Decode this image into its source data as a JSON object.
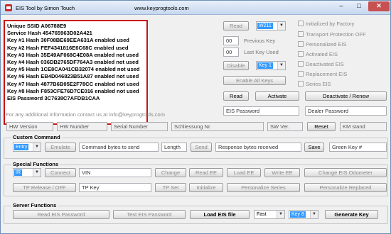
{
  "window": {
    "title": "EIS Tool by Simon Touch",
    "website": "www.keyprogtools.com"
  },
  "output_lines": [
    "Unique  SSID  A06788E9",
    "Service Hash  454765963D02A421",
    " Key #1 Hash  30F08BE69EEA631A  enabled  used",
    " Key #2 Hash  FEF4341816E6C68C  enabled  used",
    " Key #3 Hash  35E49AF068C4E08A  enabled  not used",
    " Key #4 Hash  036DB2765DF764A3  enabled  not used",
    " Key #5 Hash  1CE8CA041CB32074  enabled  not used",
    " Key #6 Hash  EB4D046823B51A87  enabled  not used",
    " Key #7 Hash  4877B6B05E2F78CC  enabled  not used",
    " Key #8 Hash  F853CFE76D7CE016  enabled  not used",
    "EIS Password  3C7638C7AFDB1CAA"
  ],
  "contact_text": "For any additional information contact us at info@keyprogtools.com",
  "right_panel": {
    "read_label": "Read",
    "read_select": "W211",
    "previous_key_value": "00",
    "previous_key_label": "Previous Key",
    "last_key_value": "00",
    "last_key_label": "Last Key Used",
    "disable_label": "Disable",
    "key_select": "Key 1",
    "enable_all_label": "Enable All Keys",
    "read2_label": "Read",
    "activate_label": "Activate",
    "deactivate_label": "Deactivate / Renew",
    "eis_password_field": "EIS Password",
    "dealer_password_field": "Dealer Password"
  },
  "checkboxes": [
    "Initialized by Factory",
    "Transport Protection OFF",
    "Personalized EIS",
    "Activated EIS",
    "Deactivated EIS",
    "Replacement EIS",
    "Series EIS"
  ],
  "info_row": {
    "hw_version": "HW Version",
    "hw_number": "HW Number",
    "serial_number": "Serial Number",
    "schliessung": "Schliessung Nr.",
    "sw_ver": "SW Ver.",
    "reset_label": "Reset",
    "km_stand": "KM stand"
  },
  "custom_command": {
    "title": "Custom Command",
    "select": "Entry",
    "emulate_label": "Emulate",
    "bytes_to_send": "Command bytes to send",
    "length": "Length",
    "send_label": "Send",
    "bytes_received": "Response bytes received",
    "save_label": "Save",
    "green_key": "Green Key #"
  },
  "special_functions": {
    "title": "Special Functions",
    "select": "IR",
    "connect_label": "Connect",
    "vin_field": "VIN",
    "change_label": "Change",
    "read_ee_label": "Read EE",
    "load_ee_label": "Load EE",
    "write_ee_label": "Write EE",
    "change_odometer_label": "Change EIS Odometer",
    "tp_release_label": "TP Release / OFF",
    "tp_key_field": "TP Key",
    "tp_set_label": "TP Set",
    "initialize_label": "Initialize",
    "personalize_series_label": "Personalize Series",
    "personalize_replaced_label": "Personalize Replaced"
  },
  "server_functions": {
    "title": "Server Functions",
    "read_eis_password_label": "Read EIS Password",
    "test_eis_password_label": "Test EIS Password",
    "load_eis_file_label": "Load EIS file",
    "speed_select": "Fast",
    "key_select": "Key 8",
    "generate_key_label": "Generate Key"
  },
  "colors": {
    "accent_red": "#cc1111",
    "selection_blue": "#3399ff",
    "title_gradient_top": "#e8f0fb"
  }
}
